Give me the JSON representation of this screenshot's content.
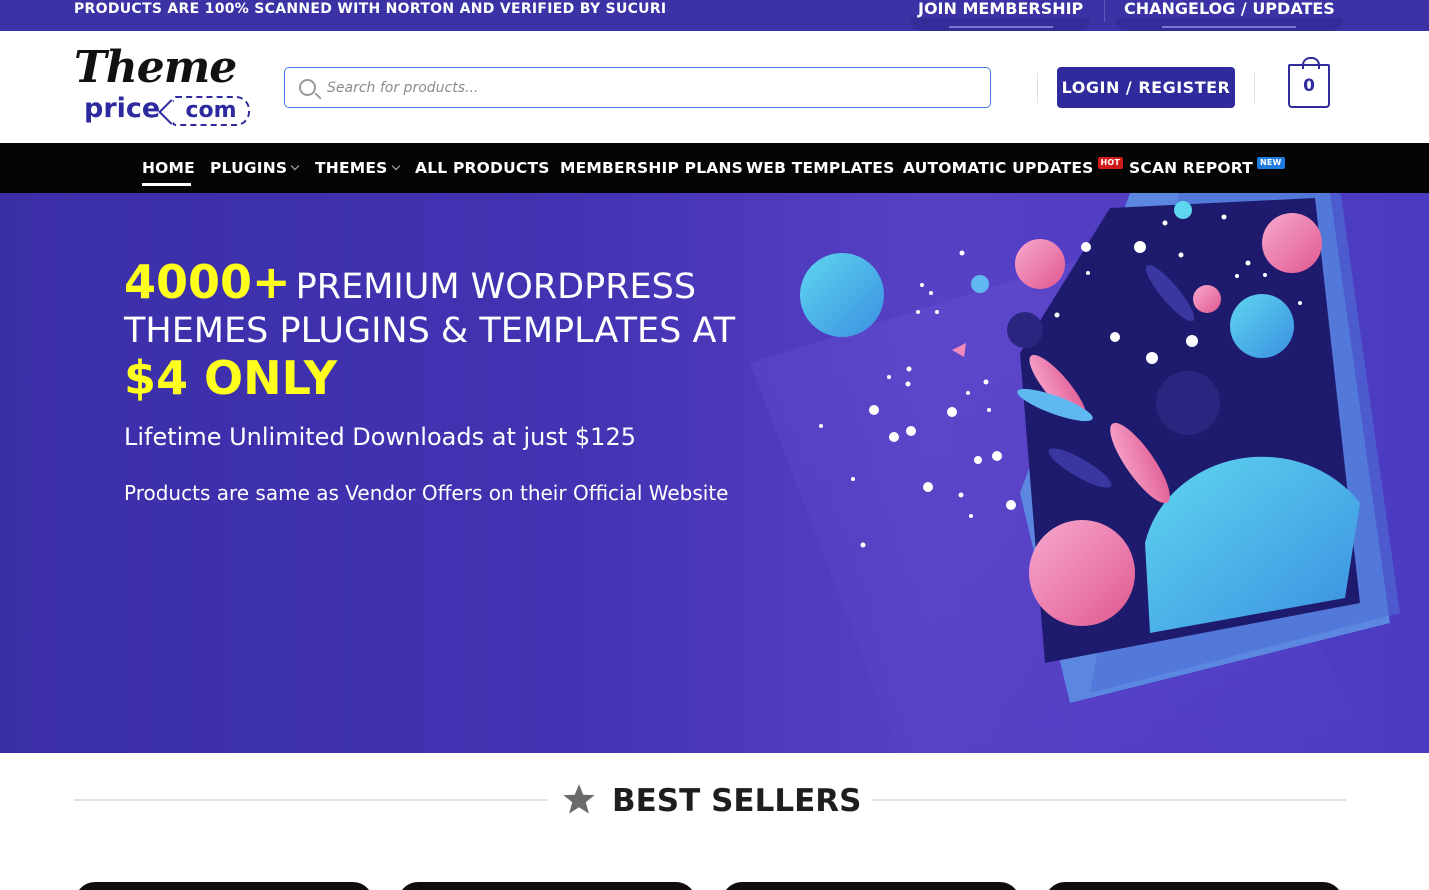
{
  "topbar": {
    "message": "PRODUCTS ARE 100% SCANNED WITH NORTON AND VERIFIED BY SUCURI",
    "links": [
      {
        "label": "JOIN MEMBERSHIP"
      },
      {
        "label": "CHANGELOG / UPDATES"
      }
    ]
  },
  "header": {
    "logo": {
      "top": "Theme",
      "bottom": "price",
      "tag": "com"
    },
    "search": {
      "placeholder": "Search for products..."
    },
    "login_label": "LOGIN / REGISTER",
    "cart_count": "0"
  },
  "nav": {
    "items": [
      {
        "label": "HOME",
        "active": true
      },
      {
        "label": "PLUGINS",
        "has_dropdown": true
      },
      {
        "label": "THEMES",
        "has_dropdown": true
      },
      {
        "label": "ALL PRODUCTS"
      },
      {
        "label": "MEMBERSHIP PLANS"
      },
      {
        "label": "WEB TEMPLATES"
      },
      {
        "label": "AUTOMATIC UPDATES",
        "badge": "HOT"
      },
      {
        "label": "SCAN REPORT",
        "badge": "NEW"
      }
    ]
  },
  "hero": {
    "highlight_count": "4000+",
    "headline_part1": "PREMIUM WORDPRESS",
    "headline_part2": "THEMES PLUGINS & TEMPLATES AT",
    "price_highlight": "$4 ONLY",
    "subtitle": "Lifetime Unlimited Downloads at just $125",
    "note": "Products are same as Vendor Offers on their Official Website"
  },
  "best_sellers": {
    "title": "BEST SELLERS",
    "icon": "star-icon"
  },
  "colors": {
    "brand": "#2f2b9c",
    "topbar": "#3a32a5",
    "nav": "#050505",
    "highlight": "#ffff1e",
    "hot_badge": "#d11a1a",
    "new_badge": "#1e7be0"
  }
}
